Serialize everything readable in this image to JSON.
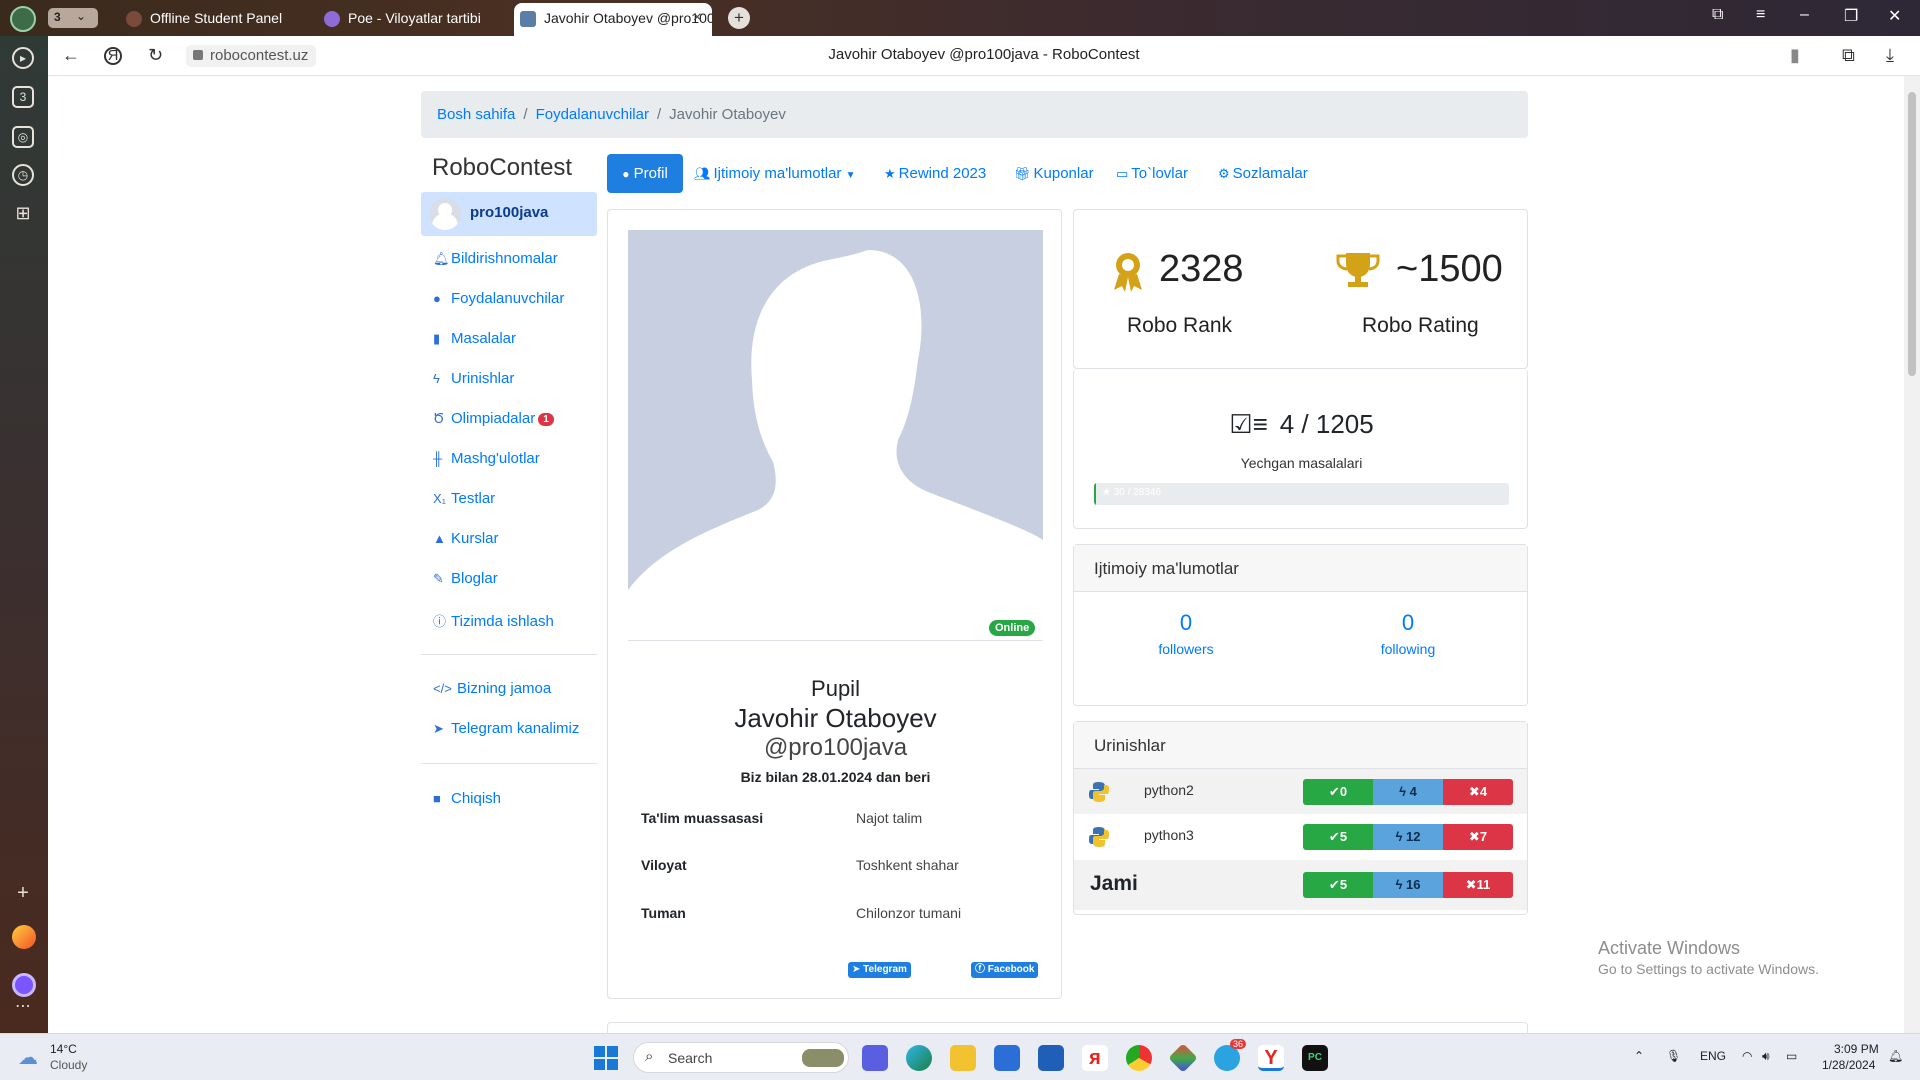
{
  "browser": {
    "tab_count": "3",
    "tabs": [
      {
        "title": "Offline Student Panel"
      },
      {
        "title": "Poe - Viloyatlar tartibi"
      },
      {
        "title": "Javohir Otaboyev @pro100java - RoboContest"
      }
    ],
    "address": "robocontest.uz",
    "page_title": "Javohir Otaboyev @pro100java - RoboContest"
  },
  "breadcrumb": {
    "home": "Bosh sahifa",
    "users": "Foydalanuvchilar",
    "current": "Javohir Otaboyev",
    "separator": "/"
  },
  "sidebar": {
    "brand": "RoboContest",
    "username": "pro100java",
    "items": [
      {
        "label": "Bildirishnomalar",
        "icon": "bell-icon"
      },
      {
        "label": "Foydalanuvchilar",
        "icon": "user-icon"
      },
      {
        "label": "Masalalar",
        "icon": "book-icon"
      },
      {
        "label": "Urinishlar",
        "icon": "bolt-icon"
      },
      {
        "label": "Olimpiadalar",
        "icon": "medal-icon",
        "badge": "1"
      },
      {
        "label": "Mashg'ulotlar",
        "icon": "dumbbell-icon"
      },
      {
        "label": "Testlar",
        "icon": "subscript-icon"
      },
      {
        "label": "Kurslar",
        "icon": "graduation-cap-icon"
      },
      {
        "label": "Bloglar",
        "icon": "pen-icon"
      },
      {
        "label": "Tizimda ishlash",
        "icon": "info-icon"
      },
      {
        "label": "Bizning jamoa",
        "icon": "code-icon"
      },
      {
        "label": "Telegram kanalimiz",
        "icon": "telegram-icon"
      },
      {
        "label": "Chiqish",
        "icon": "lock-icon"
      }
    ]
  },
  "tabs": {
    "profil": "Profil",
    "social": "Ijtimoiy ma'lumotlar",
    "rewind": "Rewind 2023",
    "coupons": "Kuponlar",
    "payments": "To`lovlar",
    "settings": "Sozlamalar"
  },
  "profile": {
    "status": "Online",
    "role": "Pupil",
    "full_name": "Javohir Otaboyev",
    "handle": "@pro100java",
    "since": "Biz bilan 28.01.2024 dan beri",
    "info": [
      {
        "label": "Ta'lim muassasasi",
        "value": "Najot talim"
      },
      {
        "label": "Viloyat",
        "value": "Toshkent shahar"
      },
      {
        "label": "Tuman",
        "value": "Chilonzor tumani"
      }
    ],
    "telegram": "Telegram",
    "facebook": "Facebook"
  },
  "stats": {
    "rank": "2328",
    "rank_label": "Robo Rank",
    "rating": "~1500",
    "rating_label": "Robo Rating",
    "solved": "4 / 1205",
    "solved_label": "Yechgan masalalari",
    "progress_text": "30 / 28346",
    "progress_fraction": 0.0011
  },
  "social": {
    "title": "Ijtimoiy ma'lumotlar",
    "followers": "0",
    "followers_label": "followers",
    "following": "0",
    "following_label": "following"
  },
  "attempts": {
    "title": "Urinishlar",
    "rows": [
      {
        "lang": "python2",
        "accepted": "0",
        "tries": "4",
        "failed": "4"
      },
      {
        "lang": "python3",
        "accepted": "5",
        "tries": "12",
        "failed": "7"
      }
    ],
    "total_label": "Jami",
    "total": {
      "accepted": "5",
      "tries": "16",
      "failed": "11"
    }
  },
  "watermark": {
    "line1": "Activate Windows",
    "line2": "Go to Settings to activate Windows."
  },
  "taskbar": {
    "temp": "14°C",
    "weather": "Cloudy",
    "search": "Search",
    "lang": "ENG",
    "time": "3:09 PM",
    "date": "1/28/2024",
    "telegram_badge": "36"
  },
  "colors": {
    "primary": "#007bff",
    "success": "#28a745",
    "danger": "#dc3545",
    "gold": "#d4a216"
  }
}
